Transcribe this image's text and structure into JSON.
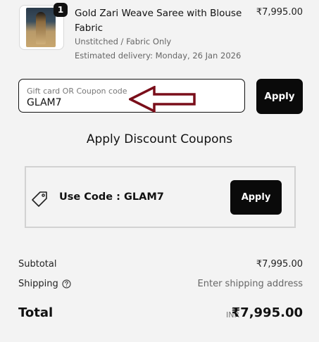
{
  "product": {
    "quantity": "1",
    "title": "Gold Zari Weave Saree with Blouse Fabric",
    "variant": "Unstitched / Fabric Only",
    "delivery": "Estimated delivery: Monday, 26 Jan 2026",
    "price": "₹7,995.00"
  },
  "coupon_input": {
    "placeholder": "Gift card OR Coupon code",
    "value": "GLAM7",
    "apply_label": "Apply"
  },
  "annotation": {
    "arrow_color": "#7a0e1a",
    "icon": "left-arrow-icon"
  },
  "discounts": {
    "title": "Apply Discount Coupons",
    "card": {
      "icon": "tag-icon",
      "label": "Use Code : GLAM7",
      "apply_label": "Apply"
    }
  },
  "summary": {
    "subtotal_label": "Subtotal",
    "subtotal_value": "₹7,995.00",
    "shipping_label": "Shipping",
    "shipping_help_icon": "help-circle-icon",
    "shipping_value": "Enter shipping address",
    "total_label": "Total",
    "total_currency": "INR",
    "total_value": "₹7,995.00"
  }
}
